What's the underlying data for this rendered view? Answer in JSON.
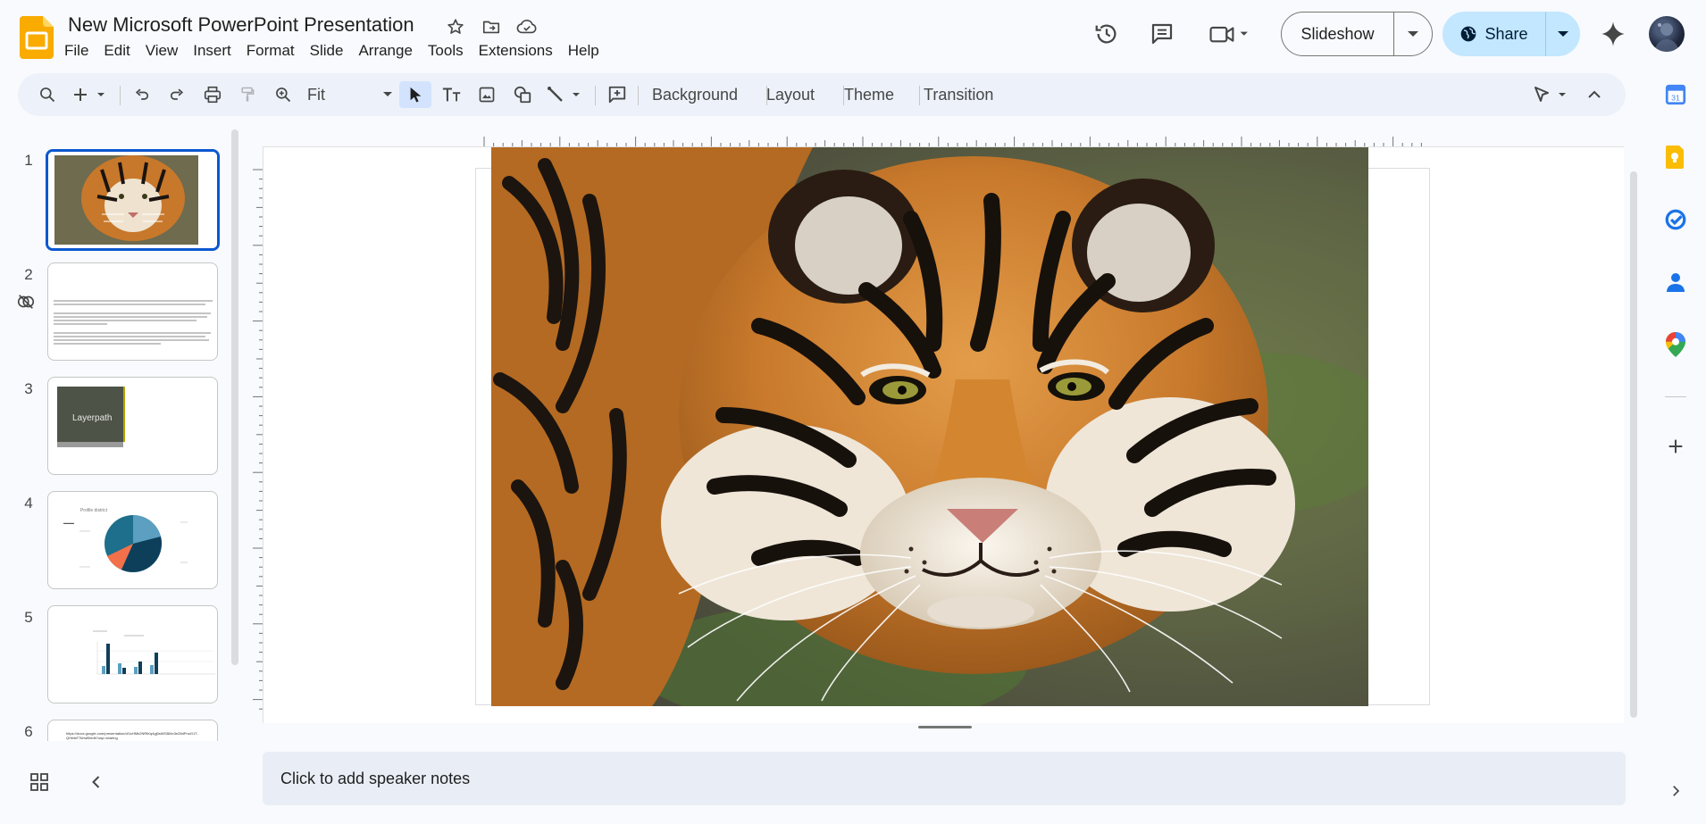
{
  "app": {
    "title": "New Microsoft PowerPoint Presentation",
    "logo_icon": "google-slides-logo",
    "brand_color": "#f9ab00"
  },
  "title_icons": [
    "star-icon",
    "move-folder-icon",
    "cloud-saved-icon"
  ],
  "menu": [
    "File",
    "Edit",
    "View",
    "Insert",
    "Format",
    "Slide",
    "Arrange",
    "Tools",
    "Extensions",
    "Help"
  ],
  "header_actions": {
    "version_history_icon": "history-icon",
    "comments_icon": "comment-icon",
    "meet_icon": "video-camera-icon",
    "slideshow_label": "Slideshow",
    "share_label": "Share",
    "share_color": "#c2e7ff"
  },
  "toolbar": {
    "zoom_label": "Fit",
    "background_label": "Background",
    "layout_label": "Layout",
    "theme_label": "Theme",
    "transition_label": "Transition"
  },
  "slides": [
    {
      "number": "1",
      "kind": "image",
      "subject": "tiger photo"
    },
    {
      "number": "2",
      "kind": "text"
    },
    {
      "number": "3",
      "kind": "image-with-caption",
      "caption": "Layerpath"
    },
    {
      "number": "4",
      "kind": "pie-chart",
      "title": "Profile district"
    },
    {
      "number": "5",
      "kind": "bar-chart"
    },
    {
      "number": "6",
      "kind": "link",
      "url": "https://docs.google.com/presentation/d/1cHMk2NRtKq4gj0sW0384e3e28dPnoG1T-QHrbkF7khwB/edit?usp=sharing"
    }
  ],
  "selected_slide": "1",
  "notes": {
    "placeholder": "Click to add speaker notes"
  },
  "side_panel": [
    "calendar-icon",
    "keep-icon",
    "tasks-icon",
    "contacts-icon",
    "maps-icon",
    "add-icon"
  ]
}
